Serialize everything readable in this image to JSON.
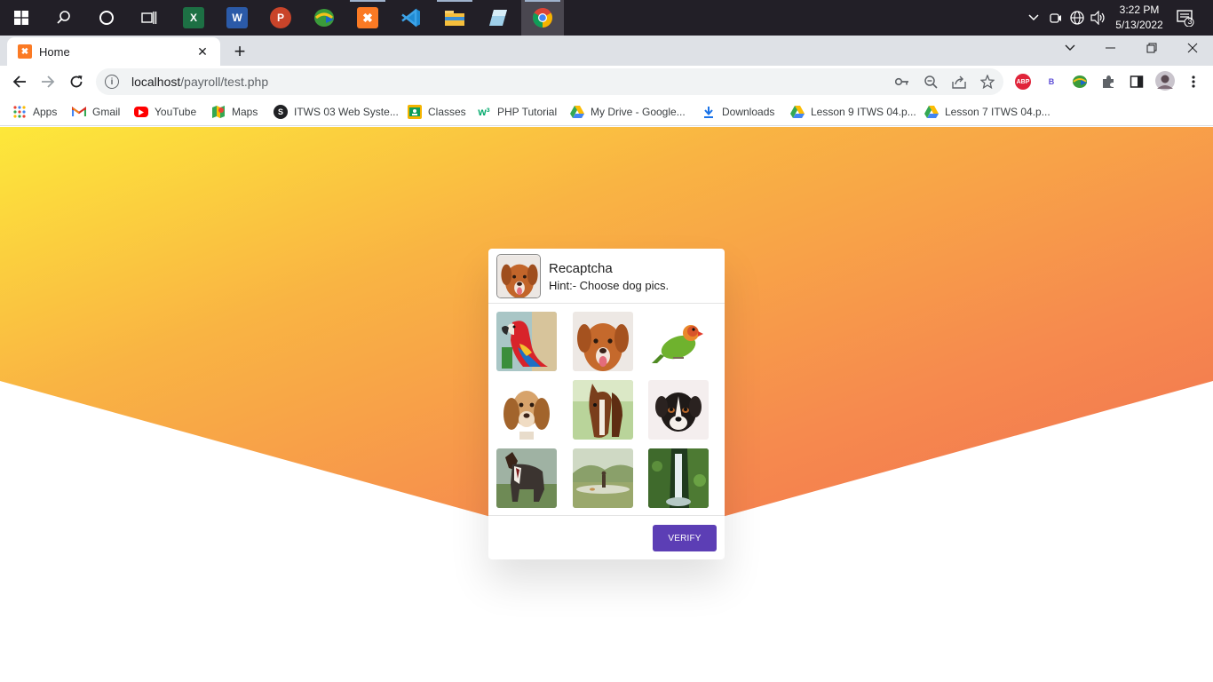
{
  "taskbar": {
    "clock_time": "3:22 PM",
    "clock_date": "5/13/2022",
    "notification_count": "3",
    "apps": [
      "start-icon",
      "search-icon",
      "cortana-icon",
      "task-view-icon",
      "excel-icon",
      "word-icon",
      "powerpoint-icon",
      "internet-download-manager-icon",
      "xampp-icon",
      "vscode-icon",
      "file-explorer-icon",
      "notepad-icon",
      "chrome-icon"
    ]
  },
  "browser": {
    "tab_title": "Home",
    "new_tab_symbol": "+",
    "url_host": "localhost",
    "url_path": "/payroll/test.php",
    "extensions": [
      "ABP",
      "B"
    ]
  },
  "bookmarks": [
    {
      "label": "Apps",
      "icon": "apps-grid-icon"
    },
    {
      "label": "Gmail",
      "icon": "gmail-icon",
      "color": "#d93025"
    },
    {
      "label": "YouTube",
      "icon": "youtube-icon",
      "color": "#ff0000"
    },
    {
      "label": "Maps",
      "icon": "maps-icon",
      "color": "#34a853"
    },
    {
      "label": "ITWS 03 Web Syste...",
      "icon": "s-icon",
      "color": "#202124"
    },
    {
      "label": "Classes",
      "icon": "classroom-icon",
      "color": "#f4b400"
    },
    {
      "label": "PHP Tutorial",
      "icon": "w3schools-icon",
      "color": "#04aa6d"
    },
    {
      "label": "My Drive - Google...",
      "icon": "drive-icon"
    },
    {
      "label": "Downloads",
      "icon": "download-icon",
      "color": "#1a73e8"
    },
    {
      "label": "Lesson 9 ITWS 04.p...",
      "icon": "drive-icon"
    },
    {
      "label": "Lesson 7 ITWS 04.p...",
      "icon": "drive-icon"
    }
  ],
  "captcha": {
    "title": "Recaptcha",
    "hint": "Hint:- Choose dog pics.",
    "verify_label": "VERIFY",
    "accent": "#5c3eb5",
    "images": [
      {
        "subject": "parrot"
      },
      {
        "subject": "dog"
      },
      {
        "subject": "parrot"
      },
      {
        "subject": "dog"
      },
      {
        "subject": "horse"
      },
      {
        "subject": "dog"
      },
      {
        "subject": "horse"
      },
      {
        "subject": "landscape"
      },
      {
        "subject": "waterfall"
      }
    ]
  }
}
